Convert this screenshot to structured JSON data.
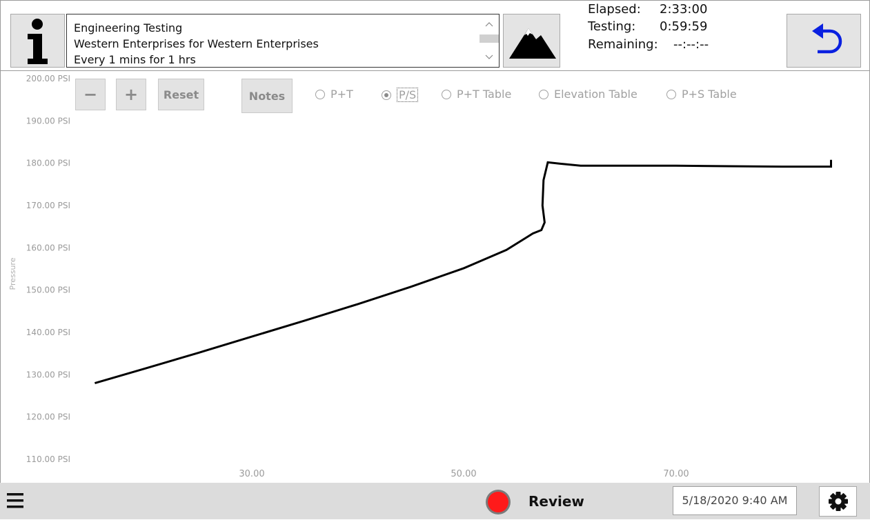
{
  "header": {
    "info_button_icon": "info-icon",
    "info_lines": [
      "Engineering Testing",
      "Western Enterprises for Western Enterprises",
      "Every 1 mins for 1 hrs"
    ],
    "elevation_button_icon": "mountain-icon",
    "timers": [
      {
        "label": "Elapsed:",
        "value": "2:33:00"
      },
      {
        "label": "Testing:",
        "value": "0:59:59"
      },
      {
        "label": "Remaining:",
        "value": "--:--:--"
      }
    ],
    "back_button_icon": "undo-arrow-icon",
    "accent_color": "#0a20e0"
  },
  "controls": {
    "zoom_out": "−",
    "zoom_in": "+",
    "reset": "Reset",
    "notes": "Notes",
    "radios": [
      {
        "label": "P+T",
        "selected": false
      },
      {
        "label": "P/S",
        "selected": true
      },
      {
        "label": "P+T Table",
        "selected": false
      },
      {
        "label": "Elevation Table",
        "selected": false
      },
      {
        "label": "P+S Table",
        "selected": false
      }
    ]
  },
  "chart_data": {
    "type": "line",
    "ylabel": "Pressure",
    "y_ticks": [
      "200.00 PSI",
      "190.00 PSI",
      "180.00 PSI",
      "170.00 PSI",
      "160.00 PSI",
      "150.00 PSI",
      "140.00 PSI",
      "130.00 PSI",
      "120.00 PSI",
      "110.00 PSI"
    ],
    "x_ticks": [
      "30.00",
      "50.00",
      "70.00"
    ],
    "ylim": [
      110,
      200
    ],
    "series": [
      {
        "x": [
          15.2,
          20,
          25,
          30,
          35,
          40,
          45,
          50,
          54,
          56.5,
          57.3,
          57.6,
          57.4,
          57.5,
          57.9,
          59,
          61,
          65,
          70,
          75,
          80,
          84.6,
          84.6
        ],
        "y": [
          128,
          131.5,
          135.2,
          139,
          142.8,
          146.7,
          150.8,
          155.2,
          159.5,
          163.4,
          164.2,
          166,
          170,
          176,
          180.2,
          179.9,
          179.4,
          179.4,
          179.4,
          179.3,
          179.2,
          179.2,
          180.8
        ]
      }
    ]
  },
  "footer": {
    "menu_icon": "hamburger-menu-icon",
    "status_color": "#ff1a1a",
    "status_label": "Review",
    "datetime": "5/18/2020 9:40 AM",
    "settings_icon": "gear-icon"
  }
}
